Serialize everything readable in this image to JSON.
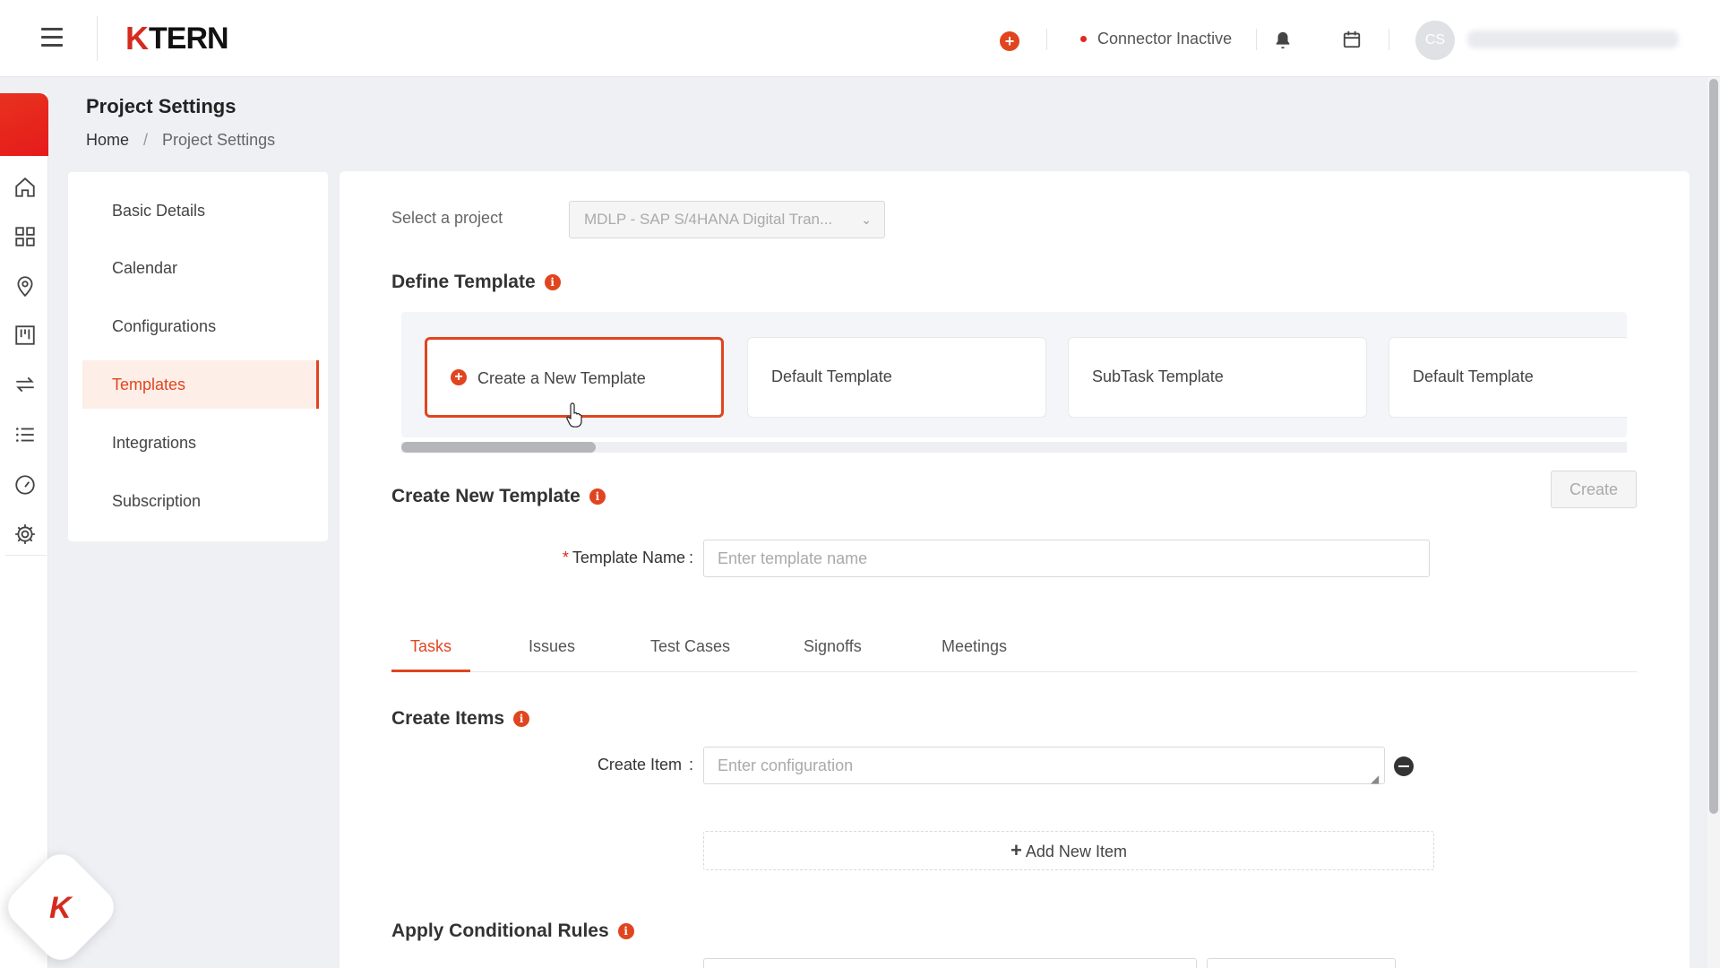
{
  "topbar": {
    "logo_k": "K",
    "logo_text": "TERN",
    "connector_status": "Connector Inactive",
    "avatar_initials": "CS",
    "colors": {
      "accent": "#e0451f",
      "status_inactive": "#e0281c"
    }
  },
  "page": {
    "title": "Project Settings",
    "breadcrumb": {
      "home": "Home",
      "separator": "/",
      "current": "Project Settings"
    }
  },
  "settings_menu": {
    "items": [
      {
        "label": "Basic Details"
      },
      {
        "label": "Calendar"
      },
      {
        "label": "Configurations"
      },
      {
        "label": "Templates",
        "active": true
      },
      {
        "label": "Integrations"
      },
      {
        "label": "Subscription"
      }
    ]
  },
  "project_select": {
    "label": "Select a project",
    "value": "MDLP - SAP S/4HANA Digital Tran..."
  },
  "define_template": {
    "title": "Define Template",
    "cards": [
      {
        "label": "Create a New Template",
        "selected": true
      },
      {
        "label": "Default Template"
      },
      {
        "label": "SubTask Template"
      },
      {
        "label": "Default Template"
      }
    ]
  },
  "create_template": {
    "title": "Create New Template",
    "create_button": "Create",
    "name_label": "Template Name",
    "name_colon": ":",
    "required_mark": "*",
    "name_placeholder": "Enter template name"
  },
  "tabs": [
    {
      "label": "Tasks",
      "active": true
    },
    {
      "label": "Issues"
    },
    {
      "label": "Test Cases"
    },
    {
      "label": "Signoffs"
    },
    {
      "label": "Meetings"
    }
  ],
  "create_items": {
    "title": "Create Items",
    "item_label": "Create Item",
    "item_colon": ":",
    "item_placeholder": "Enter configuration",
    "add_new_item": "Add New Item",
    "add_symbol": "+"
  },
  "conditional_rules": {
    "title": "Apply Conditional Rules"
  },
  "icons": {
    "info": "i",
    "chevron": "⌄"
  }
}
